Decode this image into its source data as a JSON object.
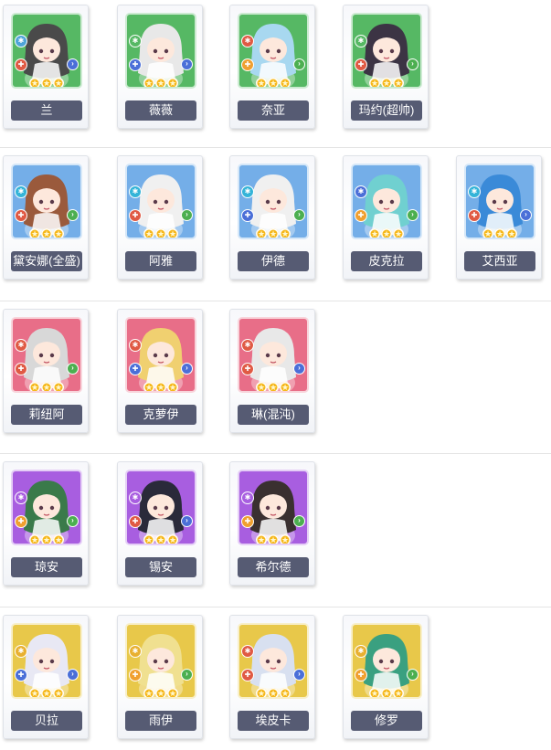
{
  "groups": [
    {
      "cards": [
        {
          "name": "兰",
          "bg": "#56b864",
          "badge_top": "#4ea4d8",
          "badge_bot": "#e05a44",
          "arrow": "#4b6fd8",
          "hair": "#4a4a4a"
        },
        {
          "name": "薇薇",
          "bg": "#56b864",
          "badge_top": "#56b864",
          "badge_bot": "#4b6fd8",
          "arrow": "#4b6fd8",
          "hair": "#e8e8e8"
        },
        {
          "name": "奈亚",
          "bg": "#56b864",
          "badge_top": "#e05a44",
          "badge_bot": "#f0a030",
          "arrow": "#4caf50",
          "hair": "#a8d8f0"
        },
        {
          "name": "玛约(超帅)",
          "bg": "#56b864",
          "badge_top": "#56b864",
          "badge_bot": "#e05a44",
          "arrow": "#4caf50",
          "hair": "#3c3444"
        }
      ]
    },
    {
      "cards": [
        {
          "name": "黛安娜(全盛)",
          "bg": "#74aee8",
          "badge_top": "#34b4d8",
          "badge_bot": "#e05a44",
          "arrow": "#4caf50",
          "hair": "#9a5a3c"
        },
        {
          "name": "阿雅",
          "bg": "#74aee8",
          "badge_top": "#34b4d8",
          "badge_bot": "#e05a44",
          "arrow": "#4caf50",
          "hair": "#f0f0f0"
        },
        {
          "name": "伊德",
          "bg": "#74aee8",
          "badge_top": "#34b4d8",
          "badge_bot": "#4b6fd8",
          "arrow": "#4caf50",
          "hair": "#f0f0f0"
        },
        {
          "name": "皮克拉",
          "bg": "#74aee8",
          "badge_top": "#4b6fd8",
          "badge_bot": "#f0a030",
          "arrow": "#4caf50",
          "hair": "#70d0d0"
        },
        {
          "name": "艾西亚",
          "bg": "#74aee8",
          "badge_top": "#34b4d8",
          "badge_bot": "#e05a44",
          "arrow": "#4b6fd8",
          "hair": "#3a8ad8"
        }
      ]
    },
    {
      "cards": [
        {
          "name": "莉纽阿",
          "bg": "#e86e88",
          "badge_top": "#e05a44",
          "badge_bot": "#e05a44",
          "arrow": "#4caf50",
          "hair": "#d8d8d8"
        },
        {
          "name": "克萝伊",
          "bg": "#e86e88",
          "badge_top": "#e05a44",
          "badge_bot": "#4b6fd8",
          "arrow": "#4b6fd8",
          "hair": "#f0d070"
        },
        {
          "name": "琳(混沌)",
          "bg": "#e86e88",
          "badge_top": "#e05a44",
          "badge_bot": "#e05a44",
          "arrow": "#4b6fd8",
          "hair": "#e8e8e8"
        }
      ]
    },
    {
      "cards": [
        {
          "name": "琼安",
          "bg": "#a85ee0",
          "badge_top": "#a85ee0",
          "badge_bot": "#f0a030",
          "arrow": "#4caf50",
          "hair": "#3a7a4a"
        },
        {
          "name": "锡安",
          "bg": "#a85ee0",
          "badge_top": "#a85ee0",
          "badge_bot": "#e05a44",
          "arrow": "#4b6fd8",
          "hair": "#2a2a3a"
        },
        {
          "name": "希尔德",
          "bg": "#a85ee0",
          "badge_top": "#a85ee0",
          "badge_bot": "#f0a030",
          "arrow": "#4caf50",
          "hair": "#3a3030"
        }
      ]
    },
    {
      "cards": [
        {
          "name": "贝拉",
          "bg": "#e8c84a",
          "badge_top": "#e8b030",
          "badge_bot": "#4b6fd8",
          "arrow": "#4b6fd8",
          "hair": "#e8e8f4"
        },
        {
          "name": "雨伊",
          "bg": "#e8c84a",
          "badge_top": "#e8b030",
          "badge_bot": "#f0a030",
          "arrow": "#4caf50",
          "hair": "#f0e090"
        },
        {
          "name": "埃皮卡",
          "bg": "#e8c84a",
          "badge_top": "#e05a44",
          "badge_bot": "#e05a44",
          "arrow": "#4b6fd8",
          "hair": "#d8e0f0"
        },
        {
          "name": "修罗",
          "bg": "#e8c84a",
          "badge_top": "#e8b030",
          "badge_bot": "#f0a030",
          "arrow": "#4caf50",
          "hair": "#3aa080"
        }
      ]
    }
  ],
  "icons": {
    "element_icon": "element-icon",
    "class_icon": "class-icon",
    "arrow_icon": "chevron-right-icon",
    "star_icon": "star-icon"
  }
}
